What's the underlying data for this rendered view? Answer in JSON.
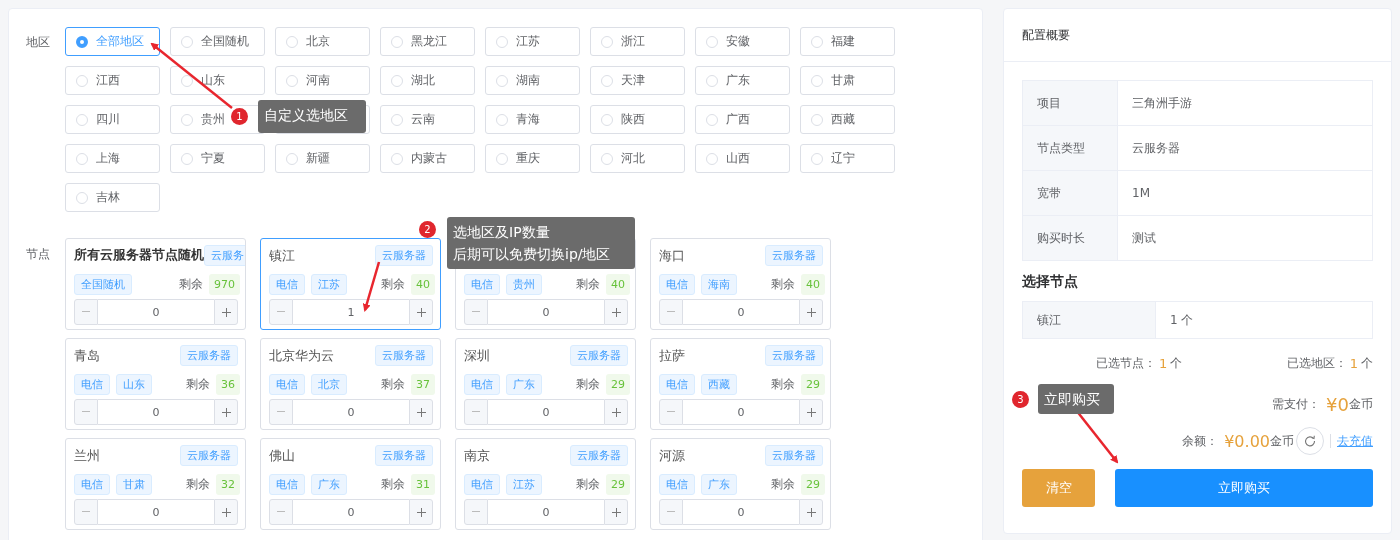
{
  "region_label": "地区",
  "regions": [
    {
      "label": "全部地区",
      "selected": true
    },
    {
      "label": "全国随机",
      "selected": false
    },
    {
      "label": "北京",
      "selected": false
    },
    {
      "label": "黑龙江",
      "selected": false
    },
    {
      "label": "江苏",
      "selected": false
    },
    {
      "label": "浙江",
      "selected": false
    },
    {
      "label": "安徽",
      "selected": false
    },
    {
      "label": "福建",
      "selected": false
    },
    {
      "label": "江西",
      "selected": false
    },
    {
      "label": "山东",
      "selected": false
    },
    {
      "label": "河南",
      "selected": false
    },
    {
      "label": "湖北",
      "selected": false
    },
    {
      "label": "湖南",
      "selected": false
    },
    {
      "label": "天津",
      "selected": false
    },
    {
      "label": "广东",
      "selected": false
    },
    {
      "label": "甘肃",
      "selected": false
    },
    {
      "label": "四川",
      "selected": false
    },
    {
      "label": "贵州",
      "selected": false
    },
    {
      "selected": false
    },
    {
      "label": "云南",
      "selected": false
    },
    {
      "label": "青海",
      "selected": false
    },
    {
      "label": "陕西",
      "selected": false
    },
    {
      "label": "广西",
      "selected": false
    },
    {
      "label": "西藏",
      "selected": false
    },
    {
      "label": "上海",
      "selected": false
    },
    {
      "label": "宁夏",
      "selected": false
    },
    {
      "label": "新疆",
      "selected": false
    },
    {
      "label": "内蒙古",
      "selected": false
    },
    {
      "label": "重庆",
      "selected": false
    },
    {
      "label": "河北",
      "selected": false
    },
    {
      "label": "山西",
      "selected": false
    },
    {
      "label": "辽宁",
      "selected": false
    },
    {
      "label": "吉林",
      "selected": false
    }
  ],
  "node_label": "节点",
  "nodes": [
    {
      "title": "所有云服务器节点随机",
      "bold": true,
      "badge": "云服务",
      "tags": [
        "全国随机"
      ],
      "remain_label": "剩余",
      "remain": "970",
      "value": "0",
      "selected": false
    },
    {
      "title": "镇江",
      "badge": "云服务器",
      "tags": [
        "电信",
        "江苏"
      ],
      "remain_label": "剩余",
      "remain": "40",
      "value": "1",
      "selected": true
    },
    {
      "tags": [
        "电信",
        "贵州"
      ],
      "remain_label": "剩余",
      "remain": "40",
      "value": "0",
      "selected": false
    },
    {
      "title": "海口",
      "badge": "云服务器",
      "tags": [
        "电信",
        "海南"
      ],
      "remain_label": "剩余",
      "remain": "40",
      "value": "0",
      "selected": false
    },
    {
      "title": "青岛",
      "badge": "云服务器",
      "tags": [
        "电信",
        "山东"
      ],
      "remain_label": "剩余",
      "remain": "36",
      "value": "0",
      "selected": false
    },
    {
      "title": "北京华为云",
      "badge": "云服务器",
      "tags": [
        "电信",
        "北京"
      ],
      "remain_label": "剩余",
      "remain": "37",
      "value": "0",
      "selected": false
    },
    {
      "title": "深圳",
      "badge": "云服务器",
      "tags": [
        "电信",
        "广东"
      ],
      "remain_label": "剩余",
      "remain": "29",
      "value": "0",
      "selected": false
    },
    {
      "title": "拉萨",
      "badge": "云服务器",
      "tags": [
        "电信",
        "西藏"
      ],
      "remain_label": "剩余",
      "remain": "29",
      "value": "0",
      "selected": false
    },
    {
      "title": "兰州",
      "badge": "云服务器",
      "tags": [
        "电信",
        "甘肃"
      ],
      "remain_label": "剩余",
      "remain": "32",
      "value": "0",
      "selected": false
    },
    {
      "title": "佛山",
      "badge": "云服务器",
      "tags": [
        "电信",
        "广东"
      ],
      "remain_label": "剩余",
      "remain": "31",
      "value": "0",
      "selected": false
    },
    {
      "title": "南京",
      "badge": "云服务器",
      "tags": [
        "电信",
        "江苏"
      ],
      "remain_label": "剩余",
      "remain": "29",
      "value": "0",
      "selected": false
    },
    {
      "title": "河源",
      "badge": "云服务器",
      "tags": [
        "电信",
        "广东"
      ],
      "remain_label": "剩余",
      "remain": "29",
      "value": "0",
      "selected": false
    }
  ],
  "summary": {
    "title": "配置概要",
    "rows": [
      {
        "label": "项目",
        "value": "三角洲手游"
      },
      {
        "label": "节点类型",
        "value": "云服务器"
      },
      {
        "label": "宽带",
        "value": "1M"
      },
      {
        "label": "购买时长",
        "value": "测试"
      }
    ],
    "nodes_heading": "选择节点",
    "chosen": [
      {
        "label": "镇江",
        "value": "1 个"
      }
    ],
    "selected_nodes": {
      "label": "已选节点：",
      "count": "1",
      "unit": "个"
    },
    "selected_regions": {
      "label": "已选地区：",
      "count": "1",
      "unit": "个"
    },
    "pay": {
      "label": "需支付：",
      "amount": "¥0",
      "unit": "金币"
    },
    "balance": {
      "label": "余额：",
      "amount": "¥0.00",
      "unit": "金币",
      "link": "去充值"
    },
    "buttons": [
      {
        "label": "清空",
        "kind": "warning"
      },
      {
        "label": "立即购买",
        "kind": "primary"
      }
    ]
  },
  "callouts": [
    {
      "number": "1",
      "lines": [
        "自定义选地区"
      ]
    },
    {
      "number": "2",
      "lines": [
        "选地区及IP数量",
        "后期可以免费切换ip/地区"
      ]
    },
    {
      "number": "3",
      "lines": [
        "立即购买"
      ]
    }
  ]
}
